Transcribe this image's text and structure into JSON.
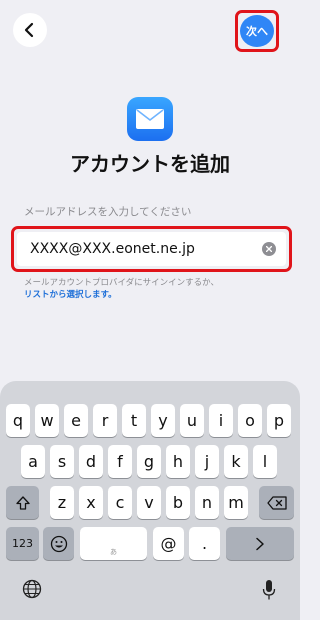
{
  "header": {
    "next_label": "次へ"
  },
  "title": "アカウントを追加",
  "email": {
    "label": "メールアドレスを入力してください",
    "value": "XXXX@XXX.eonet.ne.jp"
  },
  "hint": {
    "line1": "メールアカウントプロバイダにサインインするか、",
    "link": "リストから選択します。"
  },
  "keyboard": {
    "row1": [
      "q",
      "w",
      "e",
      "r",
      "t",
      "y",
      "u",
      "i",
      "o",
      "p"
    ],
    "row2": [
      "a",
      "s",
      "d",
      "f",
      "g",
      "h",
      "j",
      "k",
      "l"
    ],
    "row3": [
      "z",
      "x",
      "c",
      "v",
      "b",
      "n",
      "m"
    ],
    "numbers_label": "123",
    "at_label": "@",
    "dot_label": ".",
    "space_hint": "あ"
  },
  "colors": {
    "accent": "#2f86f6",
    "highlight": "#e0141a",
    "link": "#1f70d8"
  }
}
